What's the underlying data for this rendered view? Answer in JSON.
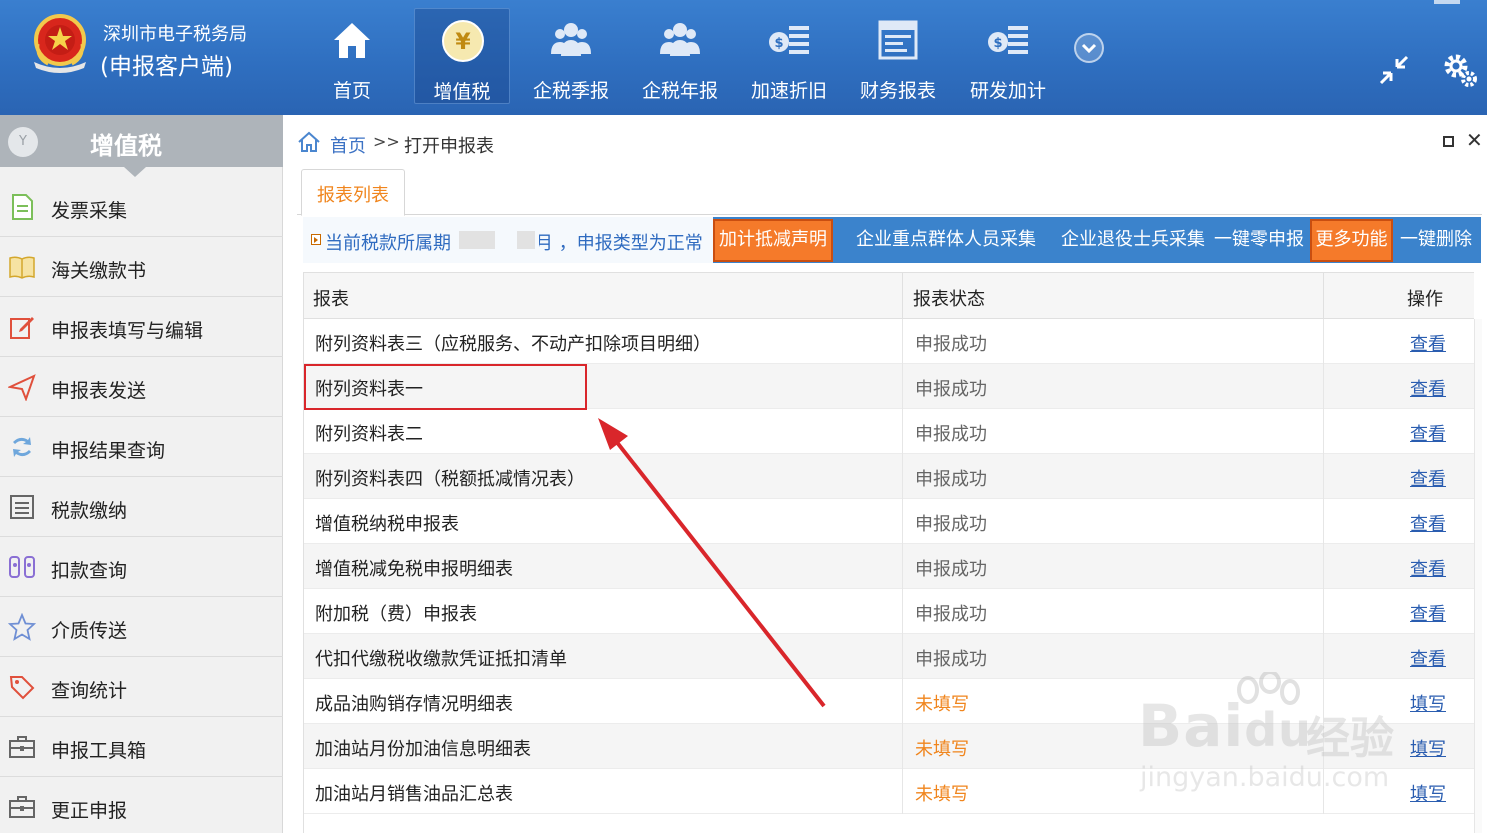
{
  "header": {
    "brand_line1": "深圳市电子税务局",
    "brand_line2": "(申报客户端)",
    "nav": [
      {
        "label": "首页",
        "icon": "home-icon"
      },
      {
        "label": "增值税",
        "icon": "yen-icon",
        "active": true
      },
      {
        "label": "企税季报",
        "icon": "people-icon"
      },
      {
        "label": "企税年报",
        "icon": "people-icon"
      },
      {
        "label": "加速折旧",
        "icon": "money-list-icon"
      },
      {
        "label": "财务报表",
        "icon": "report-icon"
      },
      {
        "label": "研发加计",
        "icon": "money-list-icon"
      }
    ]
  },
  "sidebar": {
    "title": "增值税",
    "title_icon_text": "Y",
    "items": [
      {
        "label": "发票采集",
        "icon": "document-icon"
      },
      {
        "label": "海关缴款书",
        "icon": "book-icon"
      },
      {
        "label": "申报表填写与编辑",
        "icon": "edit-icon"
      },
      {
        "label": "申报表发送",
        "icon": "send-icon"
      },
      {
        "label": "申报结果查询",
        "icon": "refresh-icon"
      },
      {
        "label": "税款缴纳",
        "icon": "list-icon"
      },
      {
        "label": "扣款查询",
        "icon": "search-person-icon"
      },
      {
        "label": "介质传送",
        "icon": "star-icon"
      },
      {
        "label": "查询统计",
        "icon": "tag-icon"
      },
      {
        "label": "申报工具箱",
        "icon": "toolbox-icon"
      },
      {
        "label": "更正申报",
        "icon": "toolbox-icon"
      }
    ]
  },
  "breadcrumb": {
    "home": "首页",
    "separator": ">>",
    "current": "打开申报表"
  },
  "tabs": {
    "active_label": "报表列表"
  },
  "infobar": {
    "text_prefix": "当前税款所属期",
    "text_suffix": "月 ，申报类型为正常",
    "buttons": [
      {
        "label": "加计抵减声明",
        "style": "orange"
      },
      {
        "label": "企业重点群体人员采集",
        "style": "blue"
      },
      {
        "label": "企业退役士兵采集",
        "style": "blue"
      },
      {
        "label": "一键零申报",
        "style": "blue"
      },
      {
        "label": "更多功能",
        "style": "orange"
      },
      {
        "label": "一键删除",
        "style": "blue"
      }
    ]
  },
  "table": {
    "columns": [
      "报表",
      "报表状态",
      "操作"
    ],
    "rows": [
      {
        "name": "附列资料表三（应税服务、不动产扣除项目明细）",
        "status": "申报成功",
        "action": "查看"
      },
      {
        "name": "附列资料表一",
        "status": "申报成功",
        "action": "查看"
      },
      {
        "name": "附列资料表二",
        "status": "申报成功",
        "action": "查看"
      },
      {
        "name": "附列资料表四（税额抵减情况表）",
        "status": "申报成功",
        "action": "查看"
      },
      {
        "name": "增值税纳税申报表",
        "status": "申报成功",
        "action": "查看"
      },
      {
        "name": "增值税减免税申报明细表",
        "status": "申报成功",
        "action": "查看"
      },
      {
        "name": "附加税（费）申报表",
        "status": "申报成功",
        "action": "查看"
      },
      {
        "name": "代扣代缴税收缴款凭证抵扣清单",
        "status": "申报成功",
        "action": "查看"
      },
      {
        "name": "成品油购销存情况明细表",
        "status": "未填写",
        "action": "填写"
      },
      {
        "name": "加油站月份加油信息明细表",
        "status": "未填写",
        "action": "填写"
      },
      {
        "name": "加油站月销售油品汇总表",
        "status": "未填写",
        "action": "填写"
      }
    ]
  },
  "colors": {
    "header_blue": "#2f6fc0",
    "accent_orange": "#f57a2a",
    "info_blue": "#3b83cc",
    "highlight_red": "#d9262b",
    "link_blue": "#2a5db0"
  },
  "watermark": {
    "logo": "Bai",
    "logo2": "du",
    "cn": "经验",
    "url": "jingyan.baidu.com"
  }
}
